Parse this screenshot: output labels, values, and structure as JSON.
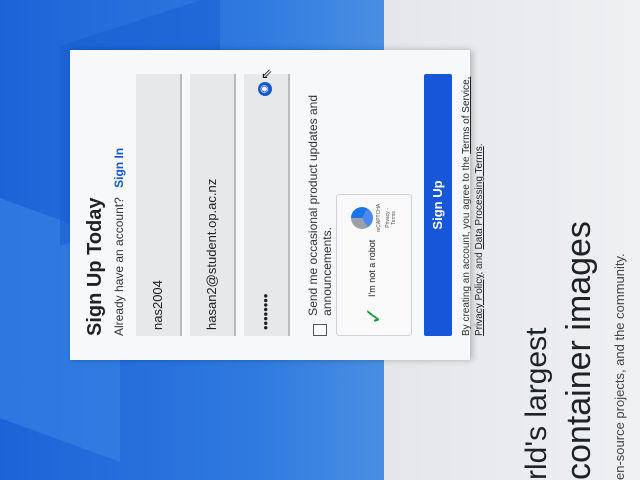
{
  "hero": {
    "line1": "rld's largest",
    "line2": "container images",
    "sub": "en-source projects, and the community."
  },
  "form": {
    "title": "Sign Up Today",
    "already_text": "Already have an account?",
    "signin_label": "Sign In",
    "username_value": "nas2004",
    "email_value": "hasan2@student.op.ac.nz",
    "password_value": "••••••••",
    "updates_label": "Send me occasional product updates and announcements.",
    "captcha_label": "I'm not a robot",
    "captcha_brand": "reCAPTCHA",
    "captcha_links": "Privacy - Terms",
    "submit_label": "Sign Up",
    "terms_prefix": "By creating an account, you agree to the",
    "terms_link": "Terms of Service,",
    "privacy_link": "Privacy Policy",
    "and_text": ", and",
    "dpa_link": "Data Processing Terms",
    "terms_suffix": "."
  }
}
